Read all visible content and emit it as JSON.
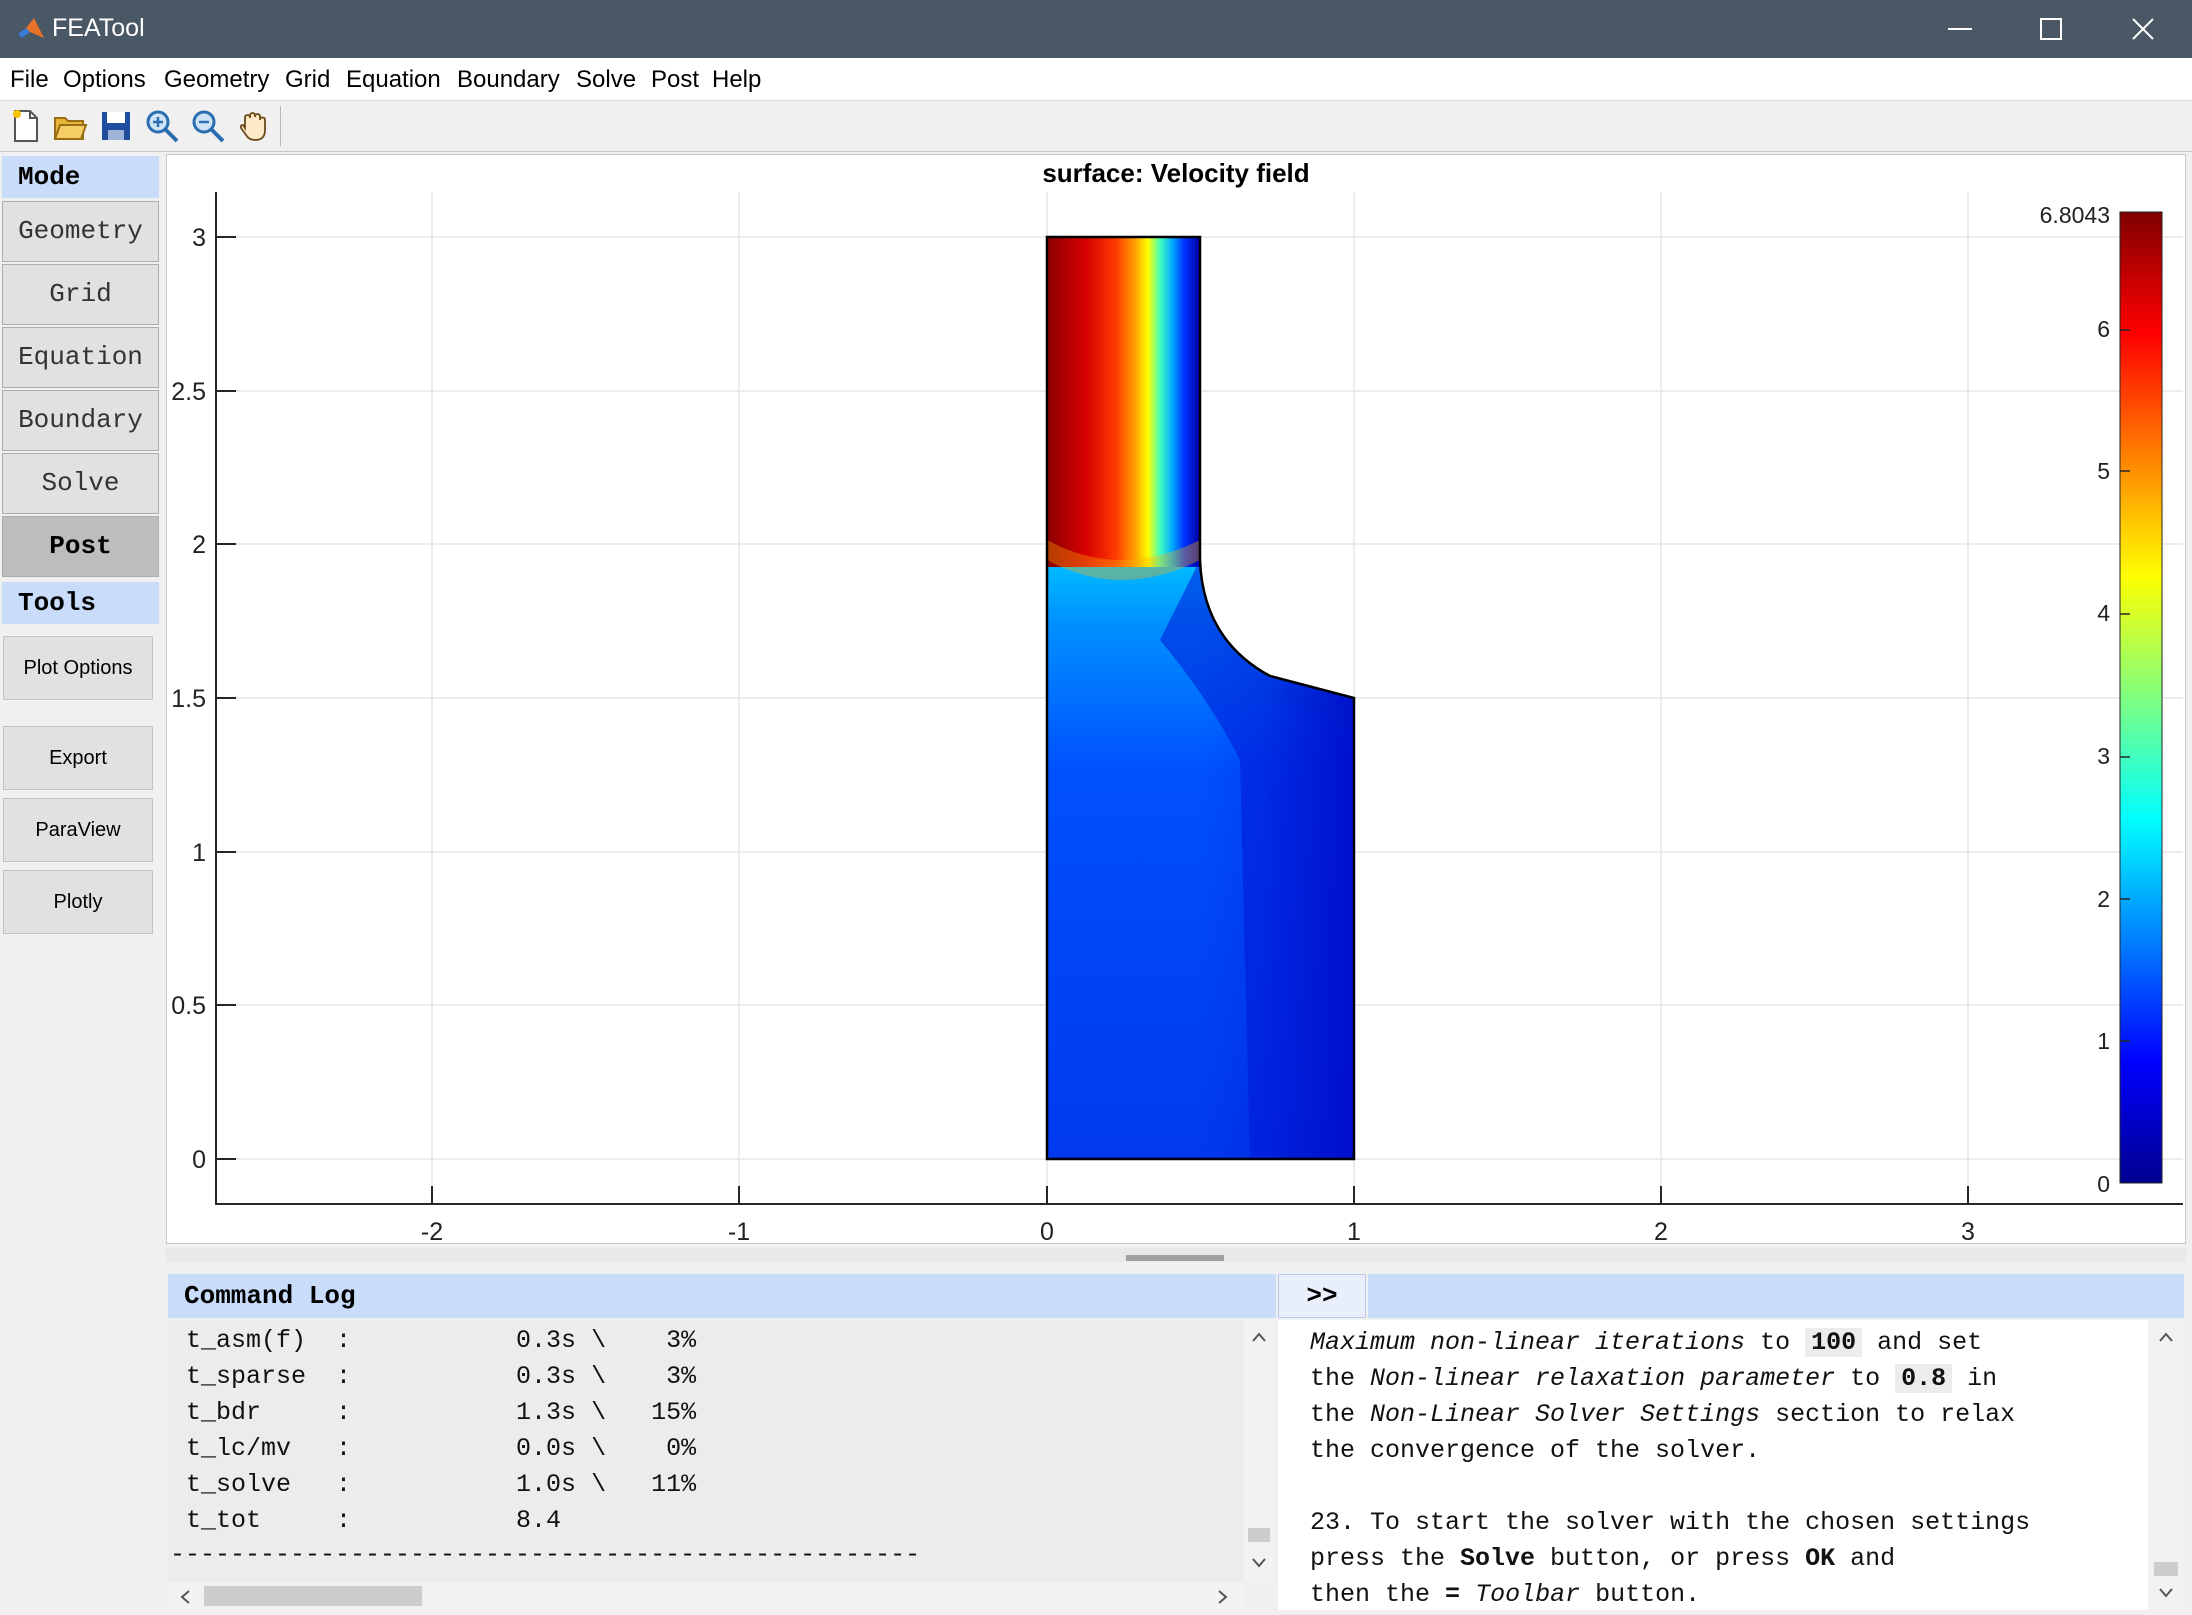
{
  "window": {
    "title": "FEATool",
    "minimize_icon": "minimize-icon",
    "maximize_icon": "maximize-icon",
    "close_icon": "close-icon"
  },
  "menu": [
    "File",
    "Options",
    "Geometry",
    "Grid",
    "Equation",
    "Boundary",
    "Solve",
    "Post",
    "Help"
  ],
  "toolbar": [
    "new-file-icon",
    "open-folder-icon",
    "save-icon",
    "zoom-in-icon",
    "zoom-out-icon",
    "pan-hand-icon"
  ],
  "sidebar": {
    "mode_header": "Mode",
    "modes": [
      "Geometry",
      "Grid",
      "Equation",
      "Boundary",
      "Solve",
      "Post"
    ],
    "active_mode": "Post",
    "tools_header": "Tools",
    "tools": [
      "Plot Options",
      "Export",
      "ParaView",
      "Plotly"
    ]
  },
  "plot": {
    "title": "surface: Velocity field",
    "y_ticks": [
      "3",
      "2.5",
      "2",
      "1.5",
      "1",
      "0.5",
      "0"
    ],
    "x_ticks": [
      "-2",
      "-1",
      "0",
      "1",
      "2",
      "3"
    ],
    "colorbar_max": "6.8043",
    "colorbar_ticks": [
      "6",
      "5",
      "4",
      "3",
      "2",
      "1",
      "0"
    ],
    "colormap": [
      "#00008f",
      "#0000ff",
      "#00ffff",
      "#ffff00",
      "#ff0000",
      "#800000"
    ]
  },
  "log": {
    "header": "Command Log",
    "expand_label": ">>",
    "lines": [
      "t_asm(f)  :           0.3s \\    3%",
      "t_sparse  :           0.3s \\    3%",
      "t_bdr     :           1.3s \\   15%",
      "t_lc/mv   :           0.0s \\    0%",
      "t_solve   :           1.0s \\   11%",
      "t_tot     :           8.4",
      "--------------------------------------------------"
    ]
  },
  "help": {
    "l1a": "Maximum non-linear iterations",
    "l1b": " to ",
    "l1c": "100",
    "l1d": " and set",
    "l2a": "the ",
    "l2b": "Non-linear relaxation parameter",
    "l2c": " to ",
    "l2d": "0.8",
    "l2e": " in",
    "l3a": "the ",
    "l3b": "Non-Linear Solver Settings",
    "l3c": " section to relax",
    "l4": "the convergence of the solver.",
    "l5": "23. To start the solver with the chosen settings",
    "l6a": "press the ",
    "l6b": "Solve",
    "l6c": " button, or press ",
    "l6d": "OK",
    "l6e": " and",
    "l7a": "then the ",
    "l7b": "=",
    "l7c": " ",
    "l7d": "Toolbar",
    "l7e": " button."
  }
}
